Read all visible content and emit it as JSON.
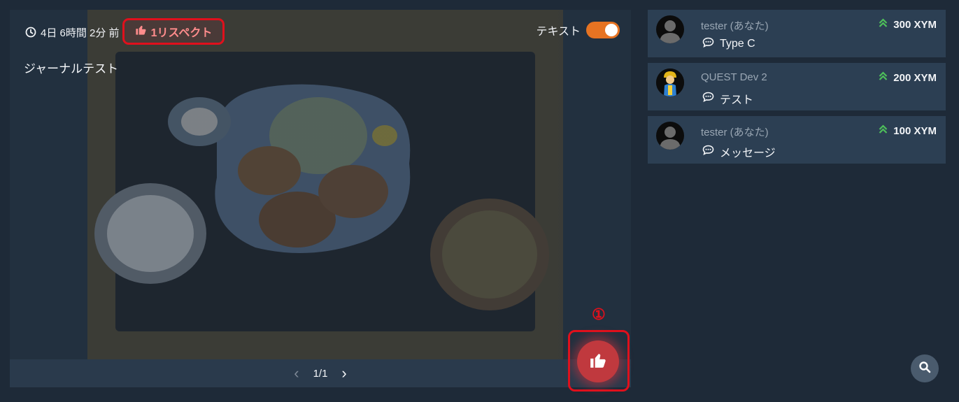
{
  "journal": {
    "elapsed": "4日 6時間 2分 前",
    "respect_label": "1リスペクト",
    "toggle_label": "テキスト",
    "body_text": "ジャーナルテスト",
    "pager_label": "1/1",
    "annotation_number": "①"
  },
  "messages": [
    {
      "name": "tester (あなた)",
      "amount": "300 XYM",
      "text": "Type C"
    },
    {
      "name": "QUEST Dev 2",
      "amount": "200 XYM",
      "text": "テスト"
    },
    {
      "name": "tester (あなた)",
      "amount": "100 XYM",
      "text": "メッセージ"
    }
  ],
  "colors": {
    "background": "#1e2a38",
    "card": "#2c3f53",
    "accent_orange": "#e67322",
    "like_red": "#c0393e",
    "annotation_red": "#e0101c",
    "amount_green": "#4ec05a"
  },
  "icons": {
    "clock": "clock-icon",
    "thumbs_up": "thumbs-up-icon",
    "chat": "chat-icon",
    "double_up": "double-chevron-up-icon",
    "search": "search-icon",
    "chevron_left": "chevron-left-icon",
    "chevron_right": "chevron-right-icon"
  }
}
